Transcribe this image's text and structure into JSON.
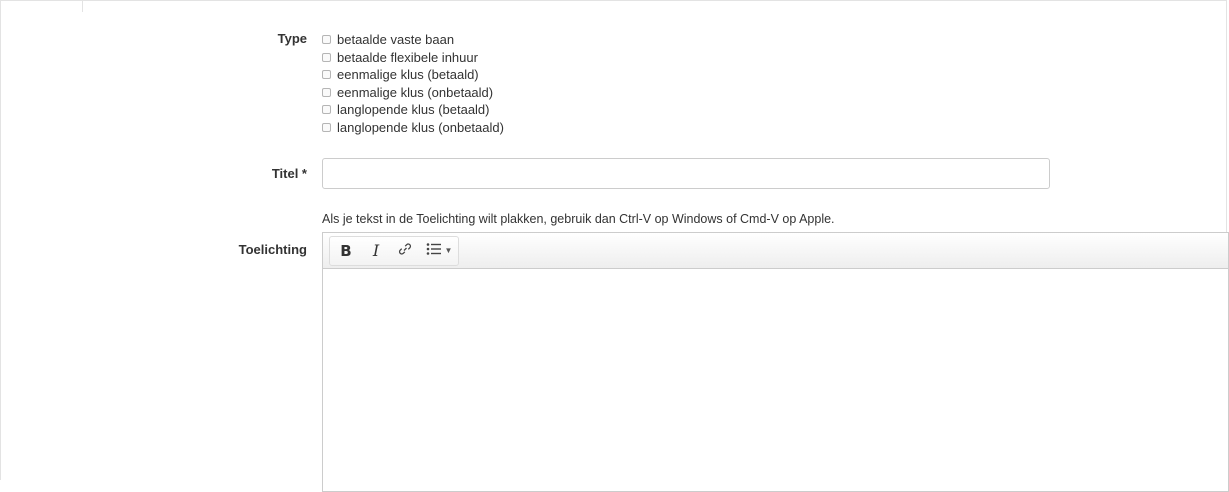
{
  "form": {
    "type_label": "Type",
    "type_options": [
      "betaalde vaste baan",
      "betaalde flexibele inhuur",
      "eenmalige klus (betaald)",
      "eenmalige klus (onbetaald)",
      "langlopende klus (betaald)",
      "langlopende klus (onbetaald)"
    ],
    "title_label": "Titel *",
    "title_value": "",
    "help_text": "Als je tekst in de Toelichting wilt plakken, gebruik dan Ctrl-V op Windows of Cmd-V op Apple.",
    "description_label": "Toelichting",
    "editor": {
      "bold_label": "B",
      "italic_label": "I",
      "link_icon": "link-icon",
      "list_icon": "unordered-list-icon",
      "dropdown_icon": "caret-down-icon"
    }
  }
}
